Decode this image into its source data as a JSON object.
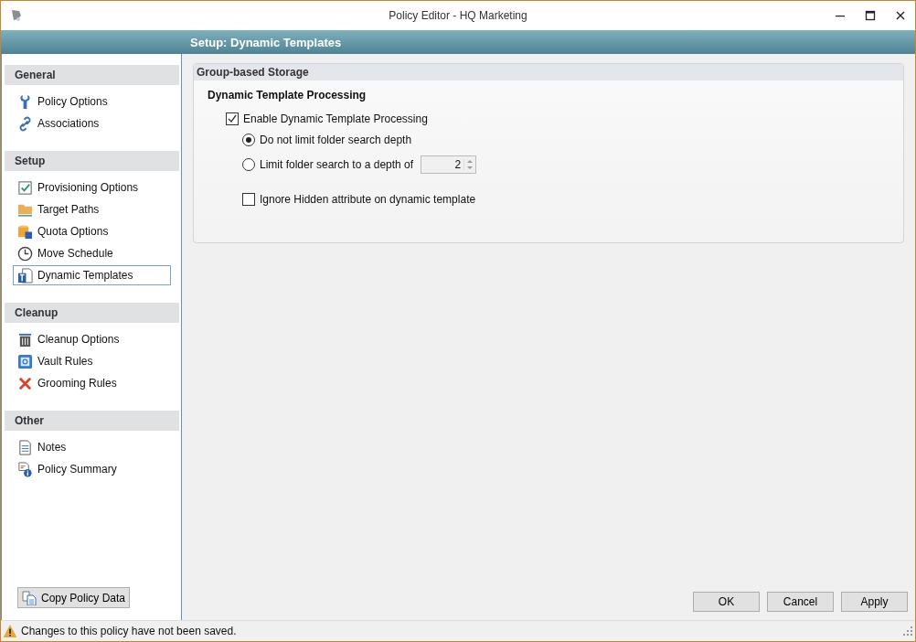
{
  "window": {
    "title": "Policy Editor - HQ Marketing"
  },
  "header": {
    "title": "Setup: Dynamic Templates"
  },
  "sidebar": {
    "sections": [
      {
        "title": "General",
        "items": [
          {
            "label": "Policy Options",
            "selected": false
          },
          {
            "label": "Associations",
            "selected": false
          }
        ]
      },
      {
        "title": "Setup",
        "items": [
          {
            "label": "Provisioning Options",
            "selected": false
          },
          {
            "label": "Target Paths",
            "selected": false
          },
          {
            "label": "Quota Options",
            "selected": false
          },
          {
            "label": "Move Schedule",
            "selected": false
          },
          {
            "label": "Dynamic Templates",
            "selected": true
          }
        ]
      },
      {
        "title": "Cleanup",
        "items": [
          {
            "label": "Cleanup Options",
            "selected": false
          },
          {
            "label": "Vault Rules",
            "selected": false
          },
          {
            "label": "Grooming Rules",
            "selected": false
          }
        ]
      },
      {
        "title": "Other",
        "items": [
          {
            "label": "Notes",
            "selected": false
          },
          {
            "label": "Policy Summary",
            "selected": false
          }
        ]
      }
    ],
    "copy_button": "Copy Policy Data"
  },
  "panel": {
    "title": "Group-based Storage",
    "subtitle": "Dynamic Template Processing",
    "enable": {
      "label": "Enable Dynamic Template Processing",
      "checked": true
    },
    "radios": [
      {
        "label": "Do not limit folder search depth",
        "selected": true
      },
      {
        "label": "Limit folder search to a depth of",
        "selected": false
      }
    ],
    "depth": {
      "value": "2",
      "disabled": true
    },
    "ignore_hidden": {
      "label": "Ignore Hidden attribute on dynamic template",
      "checked": false
    }
  },
  "buttons": [
    "OK",
    "Cancel",
    "Apply"
  ],
  "status_bar": {
    "message": "Changes to this policy have not been saved."
  }
}
